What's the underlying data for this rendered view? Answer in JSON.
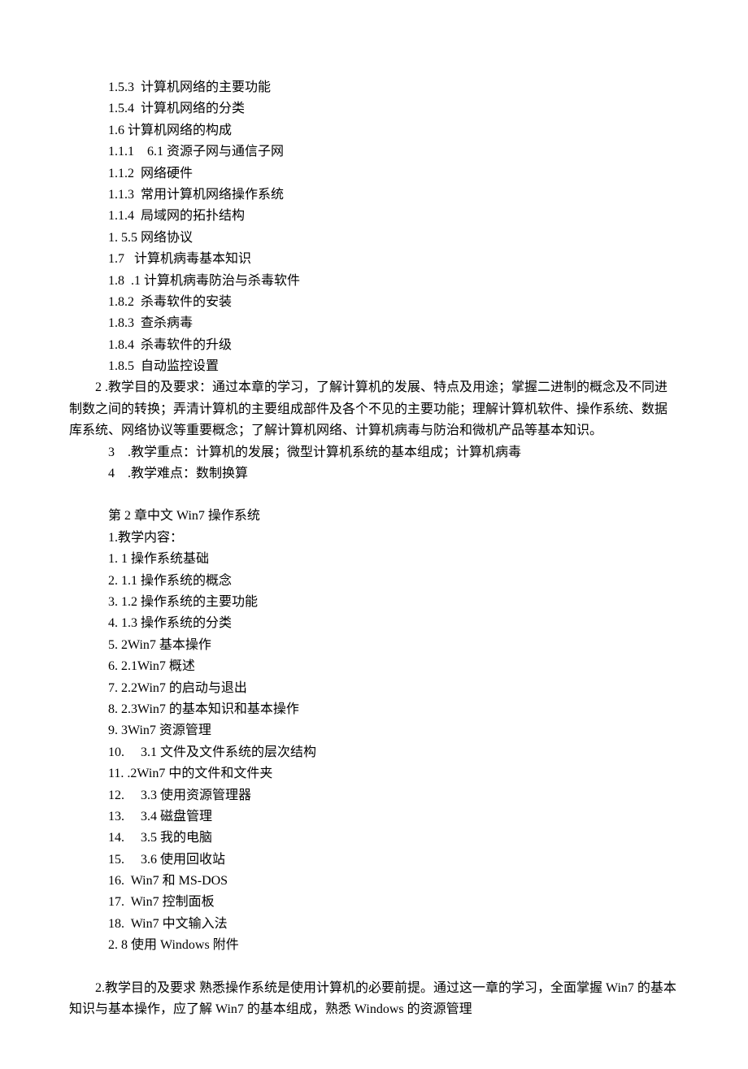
{
  "lines": {
    "l1": "1.5.3  计算机网络的主要功能",
    "l2": "1.5.4  计算机网络的分类",
    "l3": "1.6 计算机网络的构成",
    "l4": "1.1.1    6.1 资源子网与通信子网",
    "l5": "1.1.2  网络硬件",
    "l6": "1.1.3  常用计算机网络操作系统",
    "l7": "1.1.4  局域网的拓扑结构",
    "l8": "1. 5.5 网络协议",
    "l9": "1.7   计算机病毒基本知识",
    "l10": "1.8  .1 计算机病毒防治与杀毒软件",
    "l11": "1.8.2  杀毒软件的安装",
    "l12": "1.8.3  查杀病毒",
    "l13": "1.8.4  杀毒软件的升级",
    "l14": "1.8.5  自动监控设置",
    "p1": "2 .教学目的及要求：通过本章的学习，了解计算机的发展、特点及用途；掌握二进制的概念及不同进制数之间的转换；弄清计算机的主要组成部件及各个不见的主要功能；理解计算机软件、操作系统、数据库系统、网络协议等重要概念；了解计算机网络、计算机病毒与防治和微机产品等基本知识。",
    "l15": "3    .教学重点：计算机的发展；微型计算机系统的基本组成；计算机病毒",
    "l16": "4    .教学难点：数制换算",
    "h2": "第 2 章中文 Win7 操作系统",
    "l17": "1.教学内容：",
    "l18": "1. 1 操作系统基础",
    "l19": "2. 1.1 操作系统的概念",
    "l20": "3. 1.2 操作系统的主要功能",
    "l21": "4. 1.3 操作系统的分类",
    "l22": "5. 2Win7 基本操作",
    "l23": "6. 2.1Win7 概述",
    "l24": "7. 2.2Win7 的启动与退出",
    "l25": "8. 2.3Win7 的基本知识和基本操作",
    "l26": "9. 3Win7 资源管理",
    "l27": "10.     3.1 文件及文件系统的层次结构",
    "l28": "11. .2Win7 中的文件和文件夹",
    "l29": "12.     3.3 使用资源管理器",
    "l30": "13.     3.4 磁盘管理",
    "l31": "14.     3.5 我的电脑",
    "l32": "15.     3.6 使用回收站",
    "l33": "16.  Win7 和 MS-DOS",
    "l34": "17.  Win7 控制面板",
    "l35": "18.  Win7 中文输入法",
    "l36": "2. 8 使用 Windows 附件",
    "p2": "2.教学目的及要求 熟悉操作系统是使用计算机的必要前提。通过这一章的学习，全面掌握 Win7 的基本知识与基本操作，应了解 Win7 的基本组成，熟悉 Windows 的资源管理"
  }
}
